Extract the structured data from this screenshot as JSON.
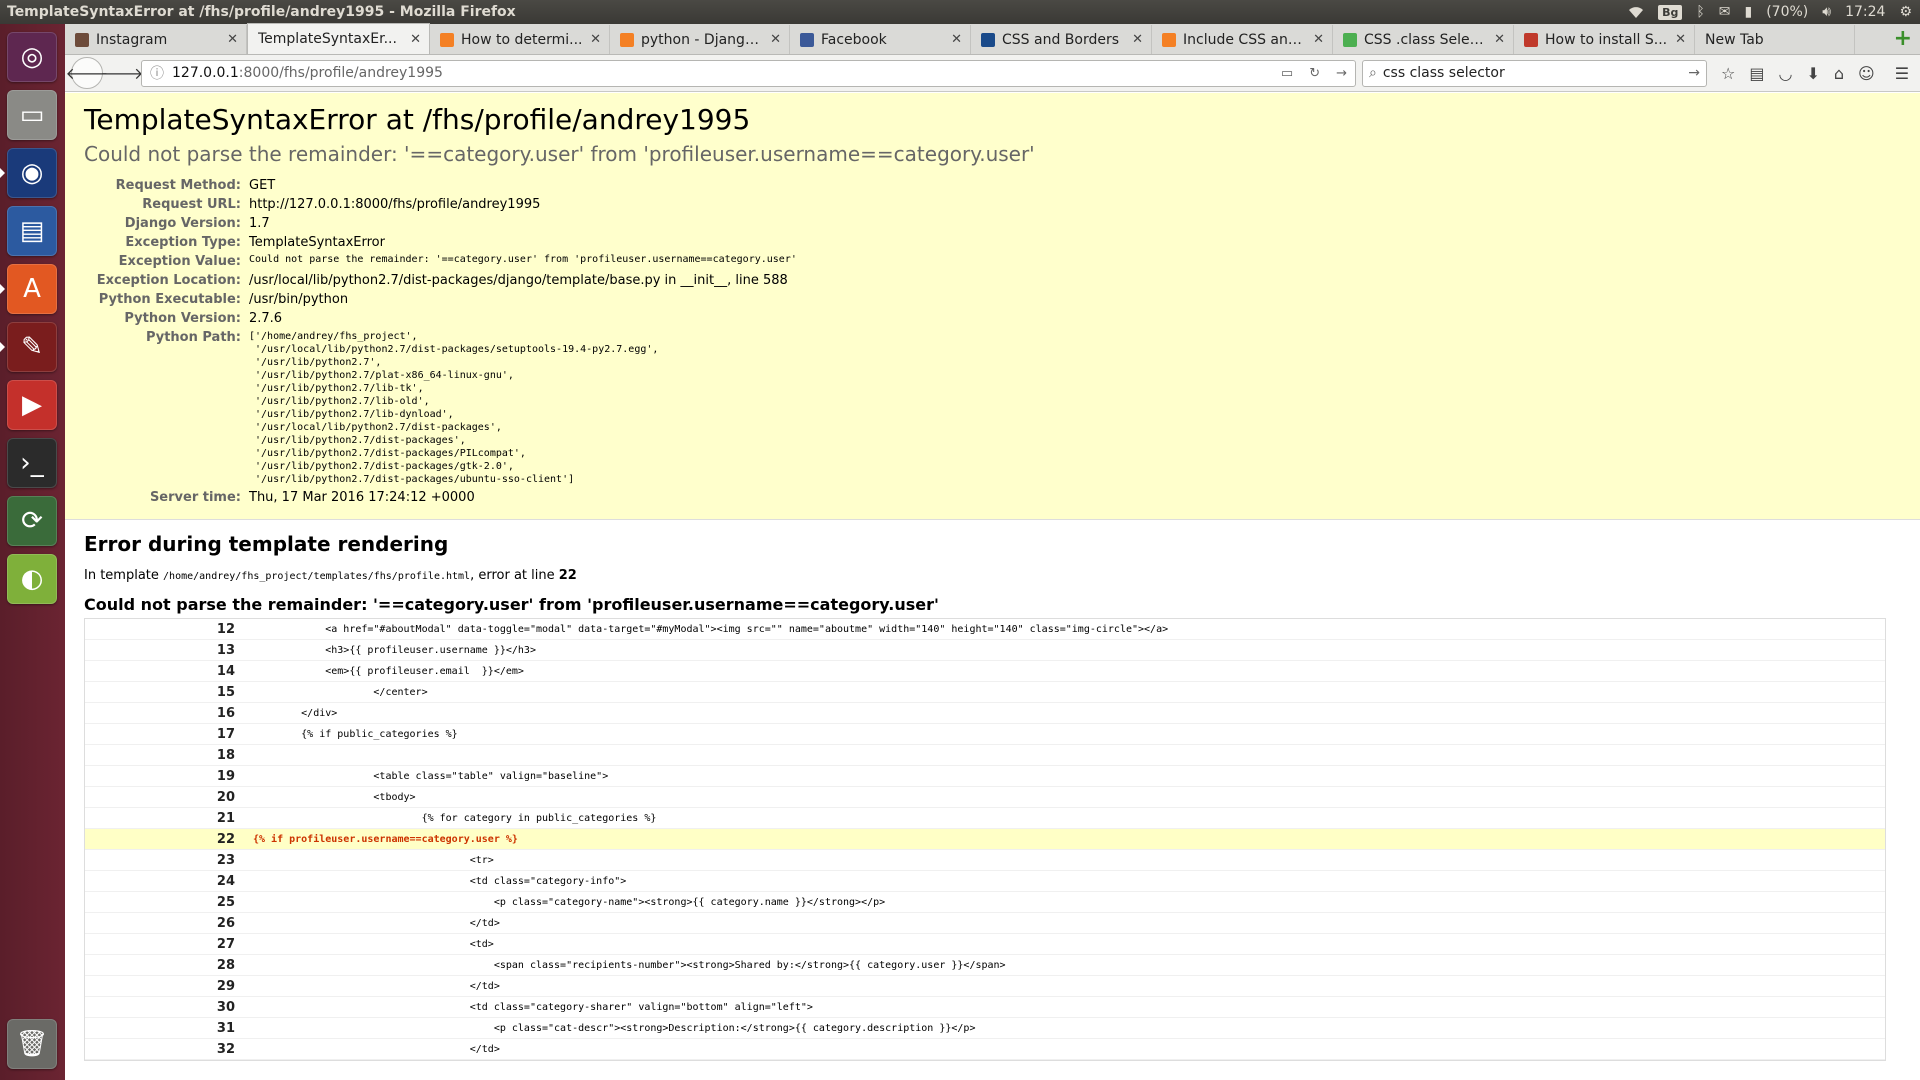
{
  "panel": {
    "window_title": "TemplateSyntaxError at /fhs/profile/andrey1995 - Mozilla Firefox",
    "keyboard_layout": "Bg",
    "battery": "(70%)",
    "clock": "17:24"
  },
  "launcher": {
    "items": [
      {
        "name": "dash-home",
        "icon": "ubuntu-logo-icon",
        "color": "#5e2750"
      },
      {
        "name": "files",
        "icon": "file-manager-icon",
        "color": "#8a8a86"
      },
      {
        "name": "firefox",
        "icon": "firefox-icon",
        "color": "#1a3a7a"
      },
      {
        "name": "writer",
        "icon": "document-icon",
        "color": "#2c5aa0"
      },
      {
        "name": "software-center",
        "icon": "software-center-icon",
        "color": "#e25822"
      },
      {
        "name": "system-settings",
        "icon": "settings-icon",
        "color": "#7a1d1d"
      },
      {
        "name": "youtube",
        "icon": "youtube-icon",
        "color": "#c4302b"
      },
      {
        "name": "terminal",
        "icon": "terminal-icon",
        "color": "#2b2b2b"
      },
      {
        "name": "software-updater",
        "icon": "update-icon",
        "color": "#3a6b3a"
      },
      {
        "name": "app",
        "icon": "app-icon",
        "color": "#7fb03a"
      }
    ],
    "trash": {
      "icon": "trash-icon"
    }
  },
  "browser": {
    "tabs": [
      {
        "label": "Instagram",
        "favicon": "instagram-icon",
        "fav_color": "#6d4b3a",
        "active": false
      },
      {
        "label": "TemplateSyntaxEr...",
        "favicon": "",
        "fav_color": "",
        "active": true
      },
      {
        "label": "How to determi...",
        "favicon": "stackoverflow-icon",
        "fav_color": "#f48024",
        "active": false
      },
      {
        "label": "python - Django...",
        "favicon": "stackoverflow-icon",
        "fav_color": "#f48024",
        "active": false
      },
      {
        "label": "Facebook",
        "favicon": "facebook-icon",
        "fav_color": "#3b5998",
        "active": false
      },
      {
        "label": "CSS and Borders",
        "favicon": "site-icon",
        "fav_color": "#1a4a8a",
        "active": false
      },
      {
        "label": "Include CSS and...",
        "favicon": "stackoverflow-icon",
        "fav_color": "#f48024",
        "active": false
      },
      {
        "label": "CSS .class Selec...",
        "favicon": "w3schools-icon",
        "fav_color": "#4caf50",
        "active": false
      },
      {
        "label": "How to install S...",
        "favicon": "site-icon",
        "fav_color": "#c0392b",
        "active": false
      },
      {
        "label": "New Tab",
        "favicon": "",
        "fav_color": "",
        "active": false
      }
    ],
    "url_host": "127.0.0.1",
    "url_path": ":8000/fhs/profile/andrey1995",
    "search_value": "css class selector"
  },
  "page": {
    "title": "TemplateSyntaxError at /fhs/profile/andrey1995",
    "subtitle": "Could not parse the remainder: '==category.user' from 'profileuser.username==category.user'",
    "meta": [
      {
        "label": "Request Method:",
        "value": "GET",
        "mono": false
      },
      {
        "label": "Request URL:",
        "value": "http://127.0.0.1:8000/fhs/profile/andrey1995",
        "mono": false
      },
      {
        "label": "Django Version:",
        "value": "1.7",
        "mono": false
      },
      {
        "label": "Exception Type:",
        "value": "TemplateSyntaxError",
        "mono": false
      },
      {
        "label": "Exception Value:",
        "value": "Could not parse the remainder: '==category.user' from 'profileuser.username==category.user'",
        "mono": true
      },
      {
        "label": "Exception Location:",
        "value": "/usr/local/lib/python2.7/dist-packages/django/template/base.py in __init__, line 588",
        "mono": false
      },
      {
        "label": "Python Executable:",
        "value": "/usr/bin/python",
        "mono": false
      },
      {
        "label": "Python Version:",
        "value": "2.7.6",
        "mono": false
      }
    ],
    "python_path_label": "Python Path:",
    "python_path": "['/home/andrey/fhs_project',\n '/usr/local/lib/python2.7/dist-packages/setuptools-19.4-py2.7.egg',\n '/usr/lib/python2.7',\n '/usr/lib/python2.7/plat-x86_64-linux-gnu',\n '/usr/lib/python2.7/lib-tk',\n '/usr/lib/python2.7/lib-old',\n '/usr/lib/python2.7/lib-dynload',\n '/usr/local/lib/python2.7/dist-packages',\n '/usr/lib/python2.7/dist-packages',\n '/usr/lib/python2.7/dist-packages/PILcompat',\n '/usr/lib/python2.7/dist-packages/gtk-2.0',\n '/usr/lib/python2.7/dist-packages/ubuntu-sso-client']",
    "server_time_label": "Server time:",
    "server_time": "Thu, 17 Mar 2016 17:24:12 +0000",
    "template_section_title": "Error during template rendering",
    "template_info_prefix": "In template ",
    "template_path": "/home/andrey/fhs_project/templates/fhs/profile.html",
    "template_info_mid": ", error at line ",
    "template_error_line": "22",
    "template_error_heading": "Could not parse the remainder: '==category.user' from 'profileuser.username==category.user'",
    "code_lines": [
      {
        "n": "12",
        "code": "            <a href=\"#aboutModal\" data-toggle=\"modal\" data-target=\"#myModal\"><img src=\"\" name=\"aboutme\" width=\"140\" height=\"140\" class=\"img-circle\"></a>",
        "err": false
      },
      {
        "n": "13",
        "code": "            <h3>{{ profileuser.username }}</h3>",
        "err": false
      },
      {
        "n": "14",
        "code": "            <em>{{ profileuser.email  }}</em>",
        "err": false
      },
      {
        "n": "15",
        "code": "                    </center>",
        "err": false
      },
      {
        "n": "16",
        "code": "        </div>",
        "err": false
      },
      {
        "n": "17",
        "code": "        {% if public_categories %}",
        "err": false
      },
      {
        "n": "18",
        "code": "",
        "err": false
      },
      {
        "n": "19",
        "code": "                    <table class=\"table\" valign=\"baseline\">",
        "err": false
      },
      {
        "n": "20",
        "code": "                    <tbody>",
        "err": false
      },
      {
        "n": "21",
        "code": "                            {% for category in public_categories %}",
        "err": false
      },
      {
        "n": "22",
        "code": "{% if profileuser.username==category.user %}",
        "err": true
      },
      {
        "n": "23",
        "code": "                                    <tr>",
        "err": false
      },
      {
        "n": "24",
        "code": "                                    <td class=\"category-info\">",
        "err": false
      },
      {
        "n": "25",
        "code": "                                        <p class=\"category-name\"><strong>{{ category.name }}</strong></p>",
        "err": false
      },
      {
        "n": "26",
        "code": "                                    </td>",
        "err": false
      },
      {
        "n": "27",
        "code": "                                    <td>",
        "err": false
      },
      {
        "n": "28",
        "code": "                                        <span class=\"recipients-number\"><strong>Shared by:</strong>{{ category.user }}</span>",
        "err": false
      },
      {
        "n": "29",
        "code": "                                    </td>",
        "err": false
      },
      {
        "n": "30",
        "code": "                                    <td class=\"category-sharer\" valign=\"bottom\" align=\"left\">",
        "err": false
      },
      {
        "n": "31",
        "code": "                                        <p class=\"cat-descr\"><strong>Description:</strong>{{ category.description }}</p>",
        "err": false
      },
      {
        "n": "32",
        "code": "                                    </td>",
        "err": false
      }
    ]
  }
}
